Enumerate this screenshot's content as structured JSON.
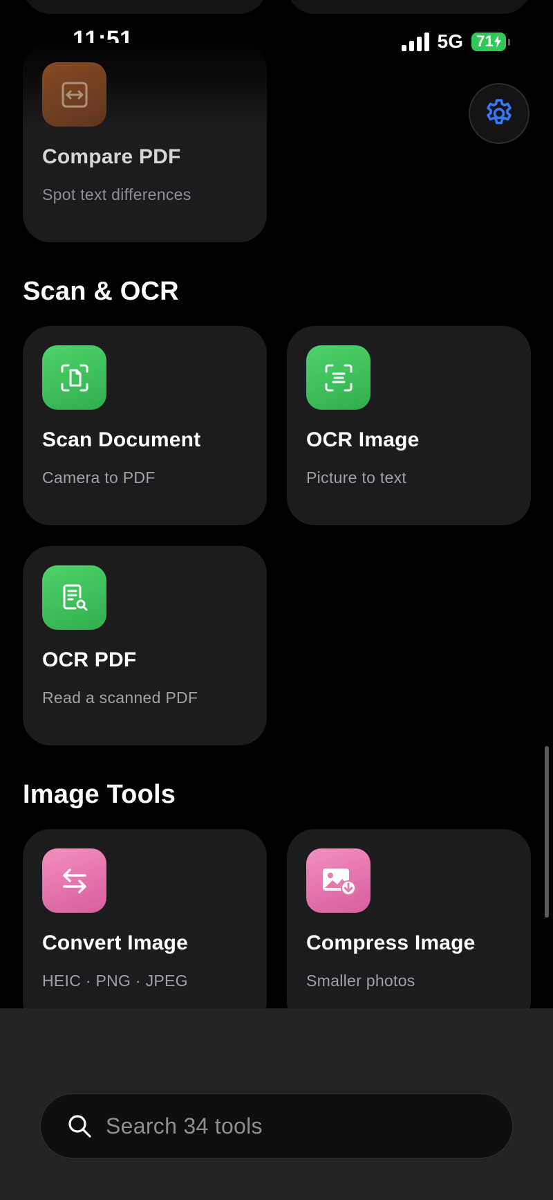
{
  "status_bar": {
    "time": "11:51",
    "network": "5G",
    "battery": "71"
  },
  "icons": {
    "settings": "gear-icon",
    "compare": "compare-arrows-icon",
    "scan": "scan-document-icon",
    "ocr_image": "text-scan-icon",
    "ocr_pdf": "document-search-icon",
    "convert": "swap-arrows-icon",
    "compress": "image-download-icon",
    "search": "search-icon"
  },
  "colors": {
    "accent_blue": "#3478f6",
    "green_tile": "#34c759",
    "pink_tile": "#e976b0",
    "orange_tile": "#8a4a24"
  },
  "compare_card": {
    "title": "Compare PDF",
    "subtitle": "Spot text differences"
  },
  "scan_section": {
    "title": "Scan & OCR",
    "items": [
      {
        "title": "Scan Document",
        "subtitle": "Camera to PDF"
      },
      {
        "title": "OCR Image",
        "subtitle": "Picture to text"
      },
      {
        "title": "OCR PDF",
        "subtitle": "Read a scanned PDF"
      }
    ]
  },
  "image_section": {
    "title": "Image Tools",
    "items": [
      {
        "title": "Convert Image",
        "subtitle": "HEIC · PNG · JPEG"
      },
      {
        "title": "Compress Image",
        "subtitle": "Smaller photos"
      }
    ]
  },
  "search": {
    "placeholder": "Search 34 tools"
  }
}
